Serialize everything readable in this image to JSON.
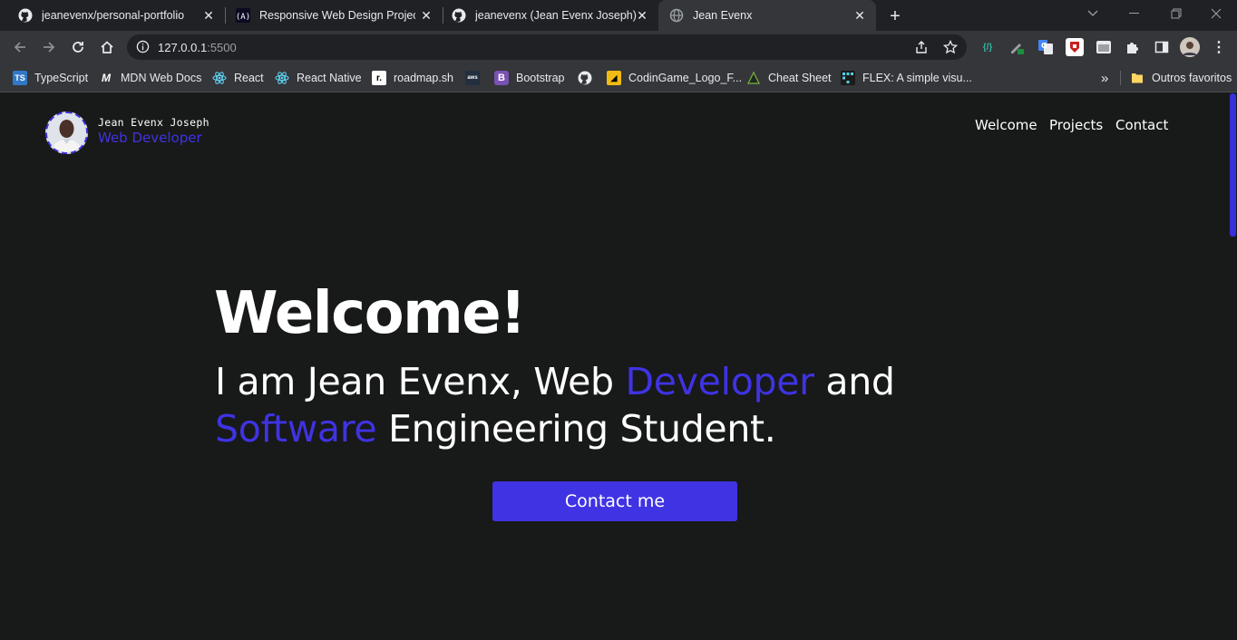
{
  "browser": {
    "tabs": [
      {
        "title": "jeanevenx/personal-portfolio",
        "icon": "github-icon"
      },
      {
        "title": "Responsive Web Design Projects",
        "icon": "freecodecamp-icon"
      },
      {
        "title": "jeanevenx (Jean Evenx Joseph)",
        "icon": "github-icon"
      },
      {
        "title": "Jean Evenx",
        "icon": "globe-icon"
      }
    ],
    "address": {
      "host": "127.0.0.1",
      "port": ":5500"
    },
    "bookmarks": [
      {
        "label": "TypeScript",
        "icon": "typescript-icon"
      },
      {
        "label": "MDN Web Docs",
        "icon": "mdn-icon"
      },
      {
        "label": "React",
        "icon": "react-icon"
      },
      {
        "label": "React Native",
        "icon": "react-icon"
      },
      {
        "label": "roadmap.sh",
        "icon": "roadmap-icon"
      },
      {
        "label": "",
        "icon": "aws-icon"
      },
      {
        "label": "Bootstrap",
        "icon": "bootstrap-icon"
      },
      {
        "label": "",
        "icon": "github-icon"
      },
      {
        "label": "CodinGame_Logo_F...",
        "icon": "codingame-icon"
      },
      {
        "label": "Cheat Sheet",
        "icon": "cheat-sheet-icon"
      },
      {
        "label": "FLEX: A simple visu...",
        "icon": "flex-icon"
      }
    ],
    "other_bookmarks": "Outros favoritos",
    "overflow": "»"
  },
  "site": {
    "brand": {
      "name": "Jean Evenx Joseph",
      "role": "Web Developer"
    },
    "nav": [
      "Welcome",
      "Projects",
      "Contact"
    ],
    "hero": {
      "title": "Welcome!",
      "subtitle_parts": [
        "I am Jean Evenx, Web ",
        "Developer",
        " and",
        "Software",
        " Engineering Student."
      ],
      "button": "Contact me"
    }
  },
  "colors": {
    "accent": "#3f33e3",
    "background": "#181919",
    "text": "#ffffff"
  }
}
